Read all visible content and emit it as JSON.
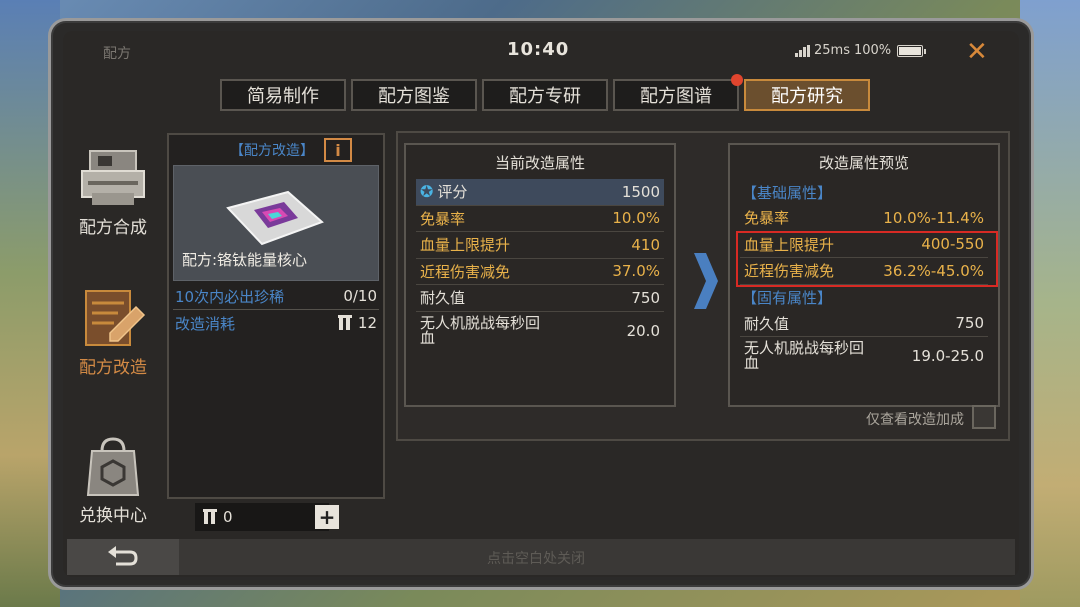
{
  "window": {
    "title": "配方",
    "clock": "10:40",
    "ping": "25ms",
    "battery": "100%"
  },
  "tabs": [
    {
      "label": "简易制作"
    },
    {
      "label": "配方图鉴"
    },
    {
      "label": "配方专研"
    },
    {
      "label": "配方图谱",
      "has_notification": true
    },
    {
      "label": "配方研究",
      "active": true
    }
  ],
  "sidebar": [
    {
      "label": "配方合成",
      "icon": "printer-icon"
    },
    {
      "label": "配方改造",
      "icon": "blueprint-edit-icon",
      "active": true
    },
    {
      "label": "兑换中心",
      "icon": "shop-bag-icon"
    }
  ],
  "left_panel": {
    "header": "【配方改造】",
    "info_label": "i",
    "item_name": "配方:铬钛能量核心",
    "guarantee_label": "10次内必出珍稀",
    "guarantee_value": "0/10",
    "cost_label": "改造消耗",
    "cost_value": "12",
    "quantity": "0",
    "plus_label": "+"
  },
  "current": {
    "title": "当前改造属性",
    "rows": [
      {
        "label": "评分",
        "value": "1500",
        "style": "score"
      },
      {
        "label": "免暴率",
        "value": "10.0%",
        "style": "orange"
      },
      {
        "label": "血量上限提升",
        "value": "410",
        "style": "orange"
      },
      {
        "label": "近程伤害减免",
        "value": "37.0%",
        "style": "orange"
      },
      {
        "label": "耐久值",
        "value": "750",
        "style": "normal"
      },
      {
        "label": "无人机脱战每秒回血",
        "value": "20.0",
        "style": "tall"
      }
    ]
  },
  "preview": {
    "title": "改造属性预览",
    "basic_section": "【基础属性】",
    "basic_rows": [
      {
        "label": "免暴率",
        "value": "10.0%-11.4%"
      },
      {
        "label": "血量上限提升",
        "value": "400-550"
      },
      {
        "label": "近程伤害减免",
        "value": "36.2%-45.0%"
      }
    ],
    "inherent_section": "【固有属性】",
    "inherent_rows": [
      {
        "label": "耐久值",
        "value": "750"
      },
      {
        "label": "无人机脱战每秒回血",
        "value": "19.0-25.0"
      }
    ]
  },
  "filter_label": "仅查看改造加成",
  "footer_hint": "点击空白处关闭",
  "colors": {
    "accent": "#c88a3c",
    "label_blue": "#4a86c8",
    "attr_orange": "#e9b24a",
    "highlight_red": "#d82a24"
  }
}
